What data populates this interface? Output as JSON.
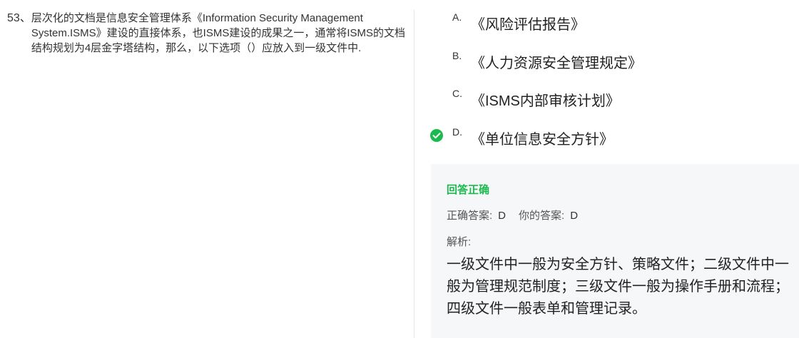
{
  "question": {
    "number": "53、",
    "text": "层次化的文档是信息安全管理体系《Information Security Management System.ISMS》建设的直接体系，也ISMS建设的成果之一，通常将ISMS的文档结构规划为4层金字塔结构，那么，以下选项（）应放入到一级文件中."
  },
  "options": [
    {
      "letter": "A.",
      "text": "《风险评估报告》"
    },
    {
      "letter": "B.",
      "text": "《人力资源安全管理规定》"
    },
    {
      "letter": "C.",
      "text": "《ISMS内部审核计划》"
    },
    {
      "letter": "D.",
      "text": "《单位信息安全方针》"
    }
  ],
  "selected_icon": "check-circle-icon",
  "result": {
    "title": "回答正确",
    "correct_label": "正确答案:",
    "correct_value": "D",
    "yours_label": "你的答案:",
    "yours_value": "D",
    "analysis_label": "解析:",
    "analysis_text": "一级文件中一般为安全方针、策略文件；二级文件中一般为管理规范制度；三级文件一般为操作手册和流程；四级文件一般表单和管理记录。"
  },
  "colors": {
    "correct_green": "#1cba4e",
    "panel_bg": "#f6f7f8",
    "divider": "#e6e6e6"
  }
}
